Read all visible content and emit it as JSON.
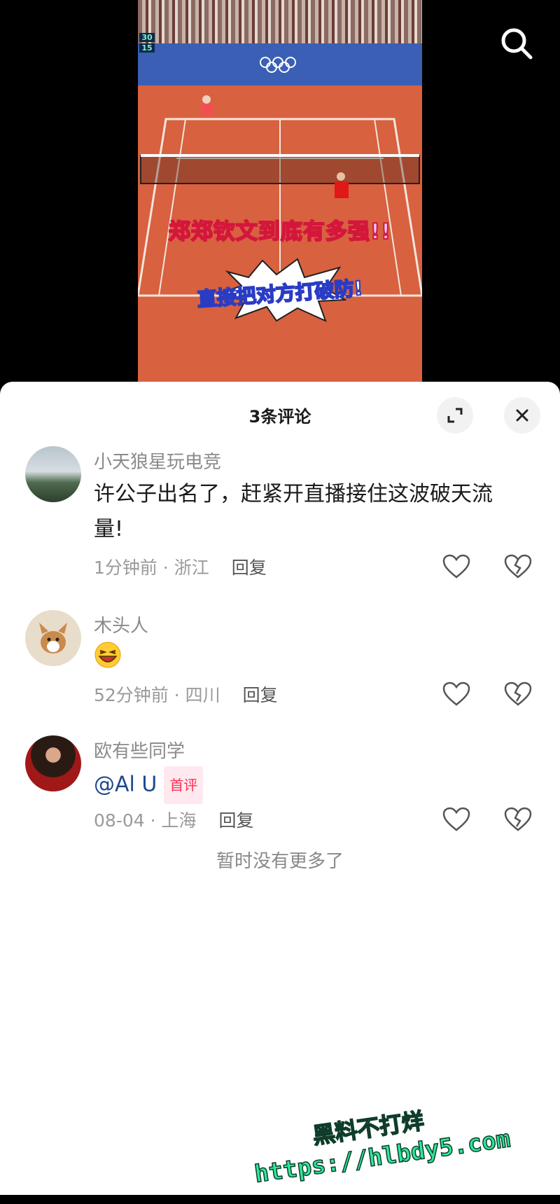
{
  "video": {
    "scoreboard": [
      "30",
      "15"
    ],
    "caption_line1": "郑郑钦文到底有多强!!",
    "caption_line2": "直接把对方打破防!"
  },
  "comments_sheet": {
    "title": "3条评论",
    "comments": [
      {
        "username": "小天狼星玩电竞",
        "text": "许公子出名了，赶紧开直播接住这波破天流量!",
        "meta": "1分钟前 · 浙江",
        "reply_label": "回复"
      },
      {
        "username": "木头人",
        "text": "",
        "emoji": "laughing-face",
        "meta": "52分钟前 · 四川",
        "reply_label": "回复"
      },
      {
        "username": "欧有些同学",
        "text": "@Al U",
        "badge": "首评",
        "meta": "08-04 · 上海",
        "reply_label": "回复"
      }
    ],
    "no_more_text": "暂时没有更多了"
  },
  "watermark": {
    "line1": "黑料不打烊",
    "line2": "https://hlbdy5.com"
  },
  "colors": {
    "accent_pink": "#ff2d55",
    "mention_blue": "#1d4a8e",
    "court_clay": "#d8613f"
  }
}
